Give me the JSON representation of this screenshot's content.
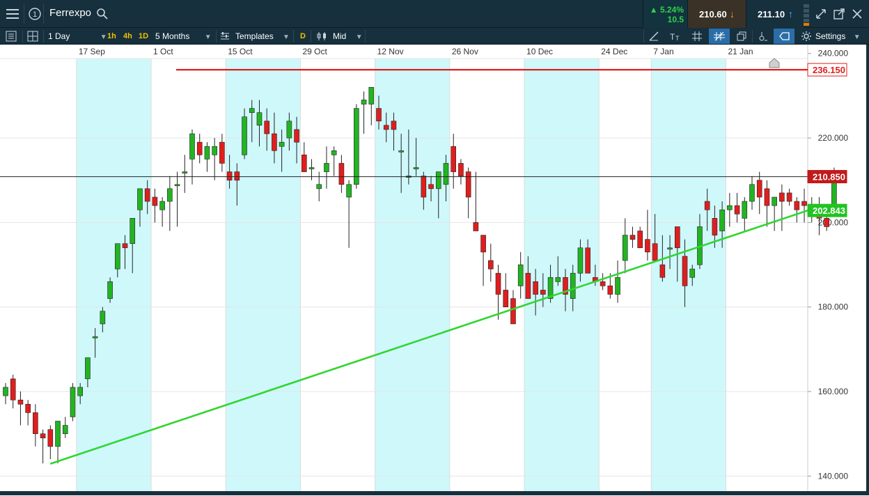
{
  "header": {
    "menu_icon": "hamburger-menu-icon",
    "badge_icon": "circled-one-icon",
    "instrument": "Ferrexpo",
    "search_icon": "search-icon",
    "change_pct": "5.24%",
    "change_abs": "10.5",
    "sell_price": "210.60",
    "buy_price": "211.10",
    "colors": {
      "up": "#2fd24a",
      "down": "#f0a030"
    }
  },
  "toolbar": {
    "interval": "1 Day",
    "quick_1h": "1h",
    "quick_4h": "4h",
    "quick_1d": "1D",
    "range": "5 Months",
    "templates": "Templates",
    "d_label": "D",
    "price_type": "Mid",
    "settings": "Settings"
  },
  "chart_data": {
    "type": "candlestick",
    "x_labels": [
      "17 Sep",
      "1 Oct",
      "15 Oct",
      "29 Oct",
      "12 Nov",
      "26 Nov",
      "10 Dec",
      "24 Dec",
      "7 Jan",
      "21 Jan"
    ],
    "y_ticks": [
      "240.000",
      "220.000",
      "200.000",
      "180.000",
      "160.000",
      "140.000"
    ],
    "ylim": [
      136.1,
      242.1
    ],
    "grid": true,
    "colors": {
      "up": "#22b422",
      "down": "#e01e1e",
      "shade": "#cff8fb",
      "support": "#2fd62f",
      "resistance": "#e51c1c"
    },
    "resistance": {
      "label": "236.150",
      "value": 236.15
    },
    "last_price": {
      "label": "210.850",
      "value": 210.85
    },
    "trendline": {
      "label": "202.843",
      "start_value": 142.9,
      "end_value": 202.843
    },
    "candles": [
      [
        159,
        162,
        157,
        161
      ],
      [
        163,
        164,
        156,
        158
      ],
      [
        158,
        160,
        152,
        157
      ],
      [
        157,
        158,
        152,
        155
      ],
      [
        155,
        157,
        147,
        150
      ],
      [
        150,
        151,
        143,
        149
      ],
      [
        151,
        152,
        144,
        147
      ],
      [
        147,
        152,
        143,
        153
      ],
      [
        150,
        154,
        149,
        152
      ],
      [
        154,
        162,
        153,
        161
      ],
      [
        159,
        162,
        157,
        161
      ],
      [
        163,
        168,
        161,
        168
      ],
      [
        173,
        175,
        168,
        173
      ],
      [
        176,
        180,
        174,
        179
      ],
      [
        182,
        187,
        181,
        186
      ],
      [
        189,
        195,
        187,
        195
      ],
      [
        195,
        197,
        189,
        194
      ],
      [
        195,
        201,
        188,
        201
      ],
      [
        203,
        207,
        199,
        208
      ],
      [
        208,
        210,
        202,
        205
      ],
      [
        206,
        208,
        200,
        204
      ],
      [
        203,
        206,
        199,
        205
      ],
      [
        205,
        211,
        198,
        208
      ],
      [
        209,
        212,
        199,
        209
      ],
      [
        212,
        216,
        207,
        212
      ],
      [
        215,
        222,
        209,
        221
      ],
      [
        219,
        221,
        214,
        216
      ],
      [
        215,
        219,
        212,
        218
      ],
      [
        216,
        220,
        210,
        218
      ],
      [
        219,
        221,
        212,
        214
      ],
      [
        212,
        216,
        208,
        210
      ],
      [
        212,
        214,
        204,
        210
      ],
      [
        216,
        227,
        215,
        225
      ],
      [
        226,
        229,
        219,
        227
      ],
      [
        223,
        229,
        218,
        226
      ],
      [
        224,
        227,
        217,
        221
      ],
      [
        221,
        226,
        214,
        217
      ],
      [
        218,
        222,
        212,
        219
      ],
      [
        220,
        226,
        217,
        224
      ],
      [
        222,
        225,
        214,
        219
      ],
      [
        216,
        219,
        212,
        212
      ],
      [
        213,
        215,
        210,
        213
      ],
      [
        208,
        212,
        205,
        209
      ],
      [
        212,
        218,
        208,
        214
      ],
      [
        216,
        218,
        211,
        217
      ],
      [
        214,
        216,
        207,
        209
      ],
      [
        206,
        210,
        194,
        209
      ],
      [
        209,
        228,
        208,
        227
      ],
      [
        228,
        231,
        221,
        229
      ],
      [
        228,
        232,
        223,
        232
      ],
      [
        227,
        230,
        222,
        224
      ],
      [
        223,
        226,
        219,
        222
      ],
      [
        224,
        226,
        217,
        222
      ],
      [
        217,
        221,
        207,
        217
      ],
      [
        211,
        222,
        209,
        211
      ],
      [
        213,
        220,
        211,
        213
      ],
      [
        211,
        212,
        203,
        206
      ],
      [
        209,
        211,
        205,
        208
      ],
      [
        208,
        212,
        201,
        212
      ],
      [
        209,
        216,
        205,
        214
      ],
      [
        218,
        221,
        208,
        212
      ],
      [
        214,
        215,
        209,
        211
      ],
      [
        212,
        213,
        201,
        206
      ],
      [
        200,
        212,
        199,
        198
      ],
      [
        197,
        197,
        185,
        193
      ],
      [
        191,
        195,
        186,
        189
      ],
      [
        188,
        190,
        177,
        183
      ],
      [
        184,
        188,
        180,
        180
      ],
      [
        182,
        184,
        177,
        176
      ],
      [
        185,
        193,
        182,
        190
      ],
      [
        188,
        192,
        182,
        182
      ],
      [
        186,
        189,
        178,
        183
      ],
      [
        184,
        188,
        180,
        183
      ],
      [
        182,
        190,
        181,
        187
      ],
      [
        186,
        192,
        185,
        187
      ],
      [
        187,
        189,
        179,
        183
      ],
      [
        182,
        190,
        179,
        188
      ],
      [
        188,
        196,
        186,
        194
      ],
      [
        194,
        196,
        188,
        188
      ],
      [
        187,
        190,
        185,
        186
      ],
      [
        186,
        188,
        184,
        185
      ],
      [
        185,
        188,
        182,
        183
      ],
      [
        183,
        191,
        181,
        187
      ],
      [
        191,
        201,
        188,
        197
      ],
      [
        197,
        199,
        194,
        196
      ],
      [
        198,
        199,
        194,
        194
      ],
      [
        196,
        203,
        191,
        193
      ],
      [
        195,
        202,
        191,
        191
      ],
      [
        190,
        197,
        186,
        187
      ],
      [
        194,
        197,
        189,
        194
      ],
      [
        199,
        198,
        186,
        194
      ],
      [
        192,
        196,
        180,
        185
      ],
      [
        187,
        190,
        185,
        189
      ],
      [
        190,
        202,
        189,
        199
      ],
      [
        205,
        208,
        198,
        203
      ],
      [
        201,
        204,
        194,
        197
      ],
      [
        198,
        205,
        194,
        203
      ],
      [
        203,
        207,
        199,
        204
      ],
      [
        204,
        207,
        200,
        202
      ],
      [
        201,
        206,
        198,
        205
      ],
      [
        205,
        211,
        203,
        209
      ],
      [
        210,
        212,
        202,
        206
      ],
      [
        208,
        210,
        199,
        204
      ],
      [
        204,
        205,
        198,
        206
      ],
      [
        207,
        209,
        198,
        205
      ],
      [
        207,
        208,
        204,
        205
      ],
      [
        205,
        206,
        200,
        203
      ],
      [
        205,
        208,
        200,
        204
      ],
      [
        204,
        206,
        200,
        204
      ],
      [
        202,
        206,
        197,
        201
      ],
      [
        201,
        203,
        198,
        199
      ],
      [
        204,
        213,
        203,
        211
      ]
    ]
  }
}
